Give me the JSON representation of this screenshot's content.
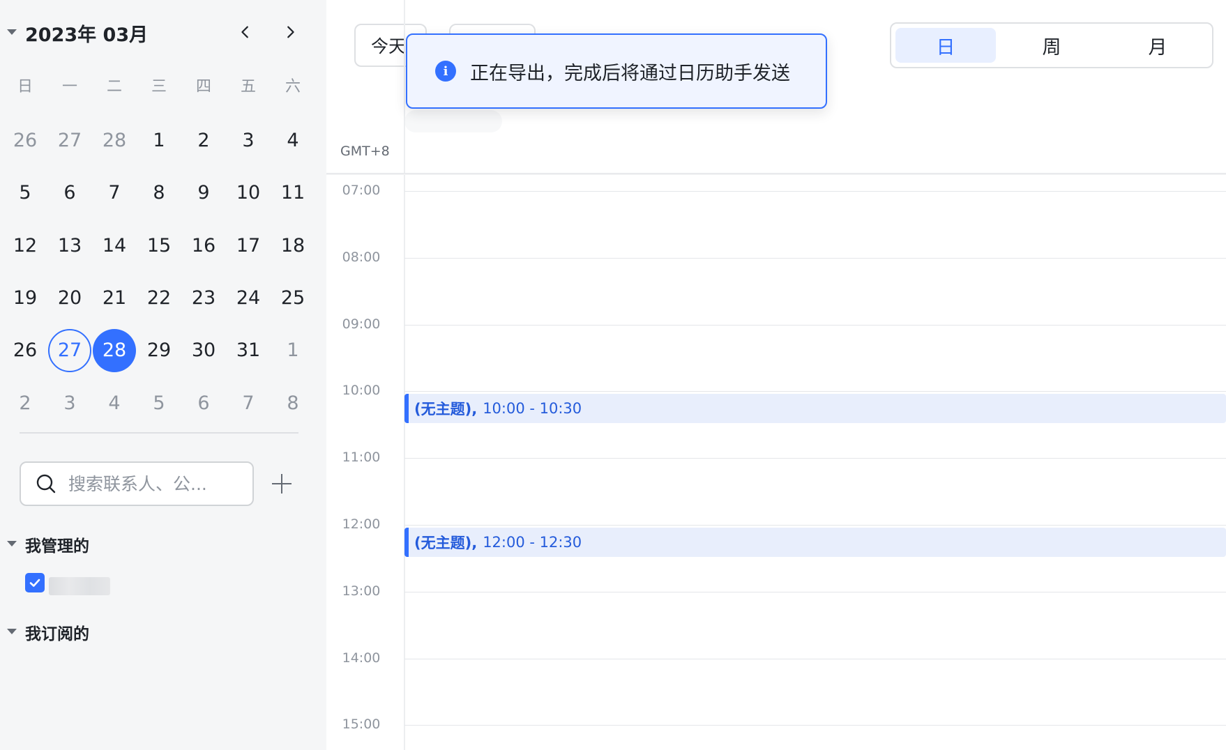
{
  "mini_calendar": {
    "title": "2023年 03月",
    "weekdays": [
      "日",
      "一",
      "二",
      "三",
      "四",
      "五",
      "六"
    ],
    "days": [
      {
        "label": "26",
        "muted": true
      },
      {
        "label": "27",
        "muted": true
      },
      {
        "label": "28",
        "muted": true
      },
      {
        "label": "1"
      },
      {
        "label": "2"
      },
      {
        "label": "3"
      },
      {
        "label": "4"
      },
      {
        "label": "5"
      },
      {
        "label": "6"
      },
      {
        "label": "7"
      },
      {
        "label": "8"
      },
      {
        "label": "9"
      },
      {
        "label": "10"
      },
      {
        "label": "11"
      },
      {
        "label": "12"
      },
      {
        "label": "13"
      },
      {
        "label": "14"
      },
      {
        "label": "15"
      },
      {
        "label": "16"
      },
      {
        "label": "17"
      },
      {
        "label": "18"
      },
      {
        "label": "19"
      },
      {
        "label": "20"
      },
      {
        "label": "21"
      },
      {
        "label": "22"
      },
      {
        "label": "23"
      },
      {
        "label": "24"
      },
      {
        "label": "25"
      },
      {
        "label": "26"
      },
      {
        "label": "27",
        "today": true
      },
      {
        "label": "28",
        "selected": true
      },
      {
        "label": "29"
      },
      {
        "label": "30"
      },
      {
        "label": "31"
      },
      {
        "label": "1",
        "muted": true
      },
      {
        "label": "2",
        "muted": true
      },
      {
        "label": "3",
        "muted": true
      },
      {
        "label": "4",
        "muted": true
      },
      {
        "label": "5",
        "muted": true
      },
      {
        "label": "6",
        "muted": true
      },
      {
        "label": "7",
        "muted": true
      },
      {
        "label": "8",
        "muted": true
      }
    ]
  },
  "search": {
    "placeholder": "搜索联系人、公..."
  },
  "groups": {
    "managed": {
      "label": "我管理的"
    },
    "subscribed": {
      "label": "我订阅的"
    }
  },
  "toolbar": {
    "today_label": "今天"
  },
  "view_switch": {
    "day": "日",
    "week": "周",
    "month": "月",
    "active": "day"
  },
  "timezone": "GMT+8",
  "hours": [
    "07:00",
    "08:00",
    "09:00",
    "10:00",
    "11:00",
    "12:00",
    "13:00",
    "14:00",
    "15:00"
  ],
  "events": [
    {
      "title": "(无主题),",
      "time": "10:00 - 10:30"
    },
    {
      "title": "(无主题),",
      "time": "12:00 - 12:30"
    }
  ],
  "toast": {
    "message": "正在导出，完成后将通过日历助手发送"
  },
  "colors": {
    "accent": "#3370ff",
    "event_bg": "#e8eefc",
    "sidebar_bg": "#f5f6f7"
  }
}
